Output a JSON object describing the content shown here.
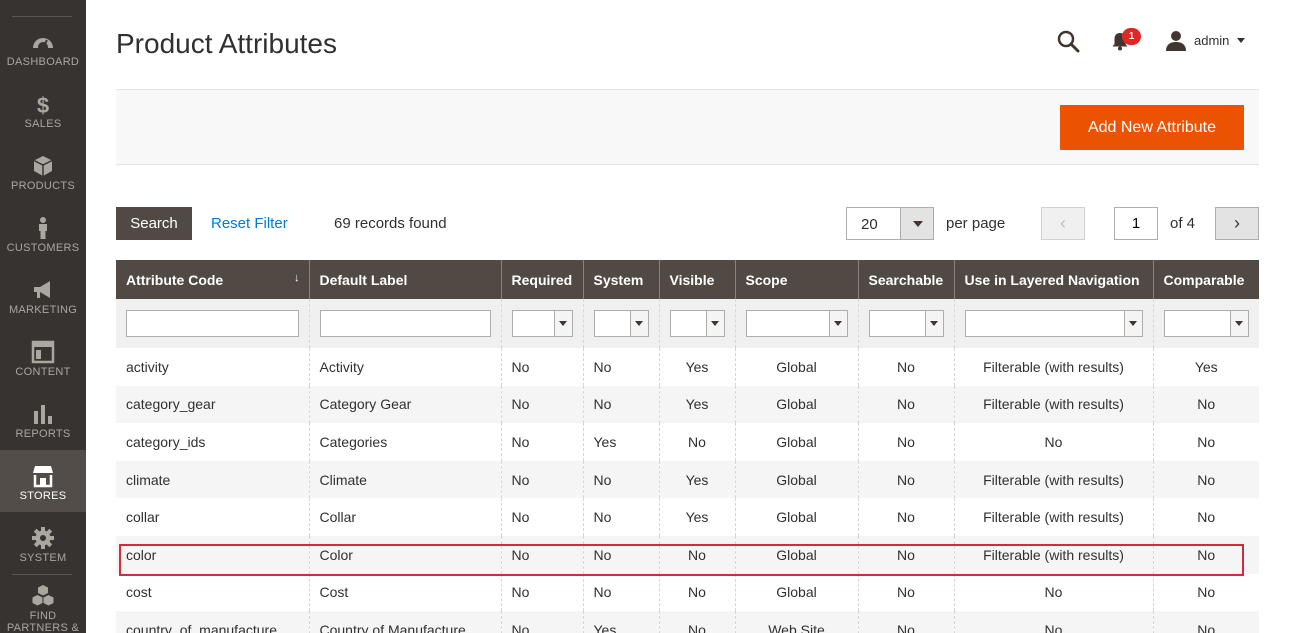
{
  "sidebar": {
    "items": [
      {
        "label": "DASHBOARD",
        "icon": "dashboard-icon"
      },
      {
        "label": "SALES",
        "icon": "dollar-icon"
      },
      {
        "label": "PRODUCTS",
        "icon": "cube-icon"
      },
      {
        "label": "CUSTOMERS",
        "icon": "person-icon"
      },
      {
        "label": "MARKETING",
        "icon": "megaphone-icon"
      },
      {
        "label": "CONTENT",
        "icon": "layout-icon"
      },
      {
        "label": "REPORTS",
        "icon": "bar-chart-icon"
      },
      {
        "label": "STORES",
        "icon": "store-icon",
        "active": true
      },
      {
        "label": "SYSTEM",
        "icon": "gear-icon"
      },
      {
        "label": "FIND PARTNERS &",
        "icon": "cubes-icon"
      }
    ]
  },
  "header": {
    "title": "Product Attributes",
    "notification_count": "1",
    "user_name": "admin"
  },
  "actions": {
    "add_button": "Add New Attribute"
  },
  "toolbar": {
    "search_label": "Search",
    "reset_label": "Reset Filter",
    "records": "69 records found",
    "per_page_value": "20",
    "per_page_label": "per page",
    "prev_symbol": "‹",
    "next_symbol": "›",
    "current_page": "1",
    "page_total": "of 4"
  },
  "columns": [
    "Attribute Code",
    "Default Label",
    "Required",
    "System",
    "Visible",
    "Scope",
    "Searchable",
    "Use in Layered Navigation",
    "Comparable"
  ],
  "sort_indicator": "↓",
  "rows": [
    [
      "activity",
      "Activity",
      "No",
      "No",
      "Yes",
      "Global",
      "No",
      "Filterable (with results)",
      "Yes"
    ],
    [
      "category_gear",
      "Category Gear",
      "No",
      "No",
      "Yes",
      "Global",
      "No",
      "Filterable (with results)",
      "No"
    ],
    [
      "category_ids",
      "Categories",
      "No",
      "Yes",
      "No",
      "Global",
      "No",
      "No",
      "No"
    ],
    [
      "climate",
      "Climate",
      "No",
      "No",
      "Yes",
      "Global",
      "No",
      "Filterable (with results)",
      "No"
    ],
    [
      "collar",
      "Collar",
      "No",
      "No",
      "Yes",
      "Global",
      "No",
      "Filterable (with results)",
      "No"
    ],
    [
      "color",
      "Color",
      "No",
      "No",
      "No",
      "Global",
      "No",
      "Filterable (with results)",
      "No"
    ],
    [
      "cost",
      "Cost",
      "No",
      "No",
      "No",
      "Global",
      "No",
      "No",
      "No"
    ],
    [
      "country_of_manufacture",
      "Country of Manufacture",
      "No",
      "Yes",
      "No",
      "Web Site",
      "No",
      "No",
      "No"
    ]
  ],
  "colors": {
    "sidebar_bg": "#373330",
    "accent": "#eb5202",
    "header_bg": "#514943",
    "link": "#007bdb",
    "highlight": "#d6293e"
  }
}
